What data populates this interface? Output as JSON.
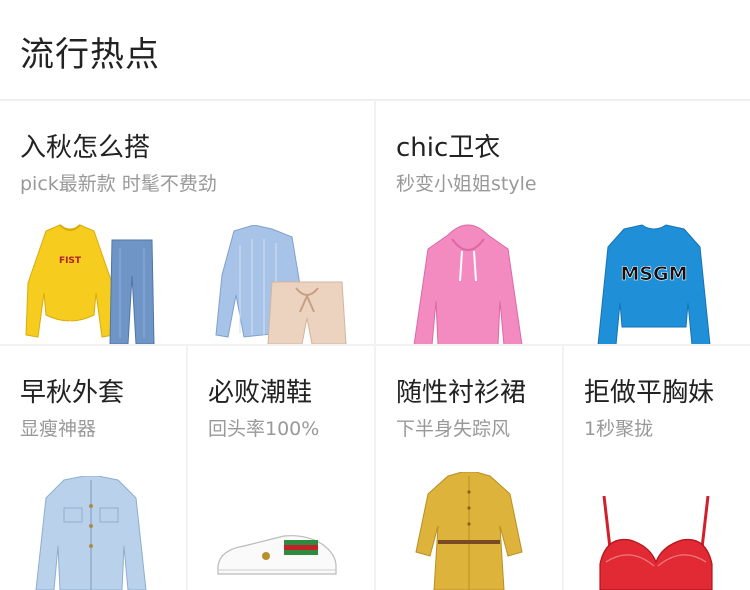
{
  "section_title": "流行热点",
  "tiles": [
    {
      "title": "入秋怎么搭",
      "subtitle": "pick最新款   时髦不费劲",
      "print_text": "FIST"
    },
    {
      "title": "chic卫衣",
      "subtitle": "秒变小姐姐style",
      "print_text": "MSGM"
    },
    {
      "title": "早秋外套",
      "subtitle": "显瘦神器"
    },
    {
      "title": "必败潮鞋",
      "subtitle": "回头率100%"
    },
    {
      "title": "随性衬衫裙",
      "subtitle": "下半身失踪风"
    },
    {
      "title": "拒做平胸妹",
      "subtitle": "1秒聚拢"
    }
  ],
  "icons": [
    "yellow-sweatshirt",
    "blue-jeans",
    "striped-shirt",
    "beige-shorts",
    "pink-hoodie",
    "blue-sweatshirt",
    "denim-jacket",
    "white-sneaker",
    "mustard-shirt-dress",
    "red-bra"
  ]
}
